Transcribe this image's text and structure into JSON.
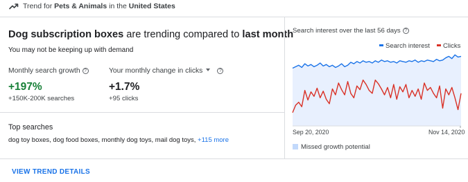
{
  "topbar": {
    "prefix": "Trend for ",
    "category": "Pets & Animals",
    "middle": " in the ",
    "location": "United States",
    "icon": "trending-up-icon"
  },
  "headline": {
    "topic": "Dog subscription boxes",
    "middle": " are trending compared to ",
    "period": "last month"
  },
  "subtext": "You may not be keeping up with demand",
  "metrics": {
    "search_growth": {
      "label": "Monthly search growth",
      "value": "+197%",
      "sub": "+150K-200K searches"
    },
    "clicks_change": {
      "label": "Your monthly change in clicks",
      "value": "+1.7%",
      "sub": "+95 clicks"
    }
  },
  "top_searches": {
    "title": "Top searches",
    "list": "dog toy boxes, dog food boxes, monthly dog toys, mail dog toys, ",
    "more": "+115 more"
  },
  "chart_data": {
    "type": "line",
    "title": "Search interest over the last 56 days",
    "x_labels": [
      "Sep 20, 2020",
      "Nov 14, 2020"
    ],
    "ylim": [
      0,
      100
    ],
    "series": [
      {
        "name": "Search interest",
        "color": "#1a73e8",
        "values": [
          78,
          80,
          82,
          79,
          84,
          81,
          83,
          80,
          82,
          85,
          81,
          83,
          80,
          82,
          79,
          81,
          84,
          80,
          82,
          86,
          84,
          87,
          85,
          88,
          86,
          87,
          85,
          88,
          86,
          89,
          87,
          88,
          86,
          87,
          85,
          88,
          87,
          86,
          88,
          87,
          89,
          86,
          88,
          87,
          89,
          88,
          87,
          90,
          88,
          89,
          92,
          94,
          91,
          96,
          93,
          94
        ]
      },
      {
        "name": "Clicks",
        "color": "#d93025",
        "values": [
          18,
          28,
          32,
          26,
          48,
          35,
          46,
          40,
          51,
          38,
          47,
          36,
          30,
          50,
          42,
          58,
          49,
          42,
          60,
          44,
          38,
          54,
          49,
          62,
          56,
          48,
          44,
          62,
          57,
          50,
          42,
          52,
          38,
          56,
          36,
          53,
          46,
          56,
          38,
          48,
          40,
          50,
          36,
          58,
          48,
          52,
          44,
          38,
          54,
          24,
          50,
          42,
          52,
          38,
          22,
          44
        ]
      }
    ],
    "area_label": "Missed growth potential",
    "area_color": "#e8f0fe"
  },
  "footer": {
    "link_label": "VIEW TREND DETAILS"
  }
}
